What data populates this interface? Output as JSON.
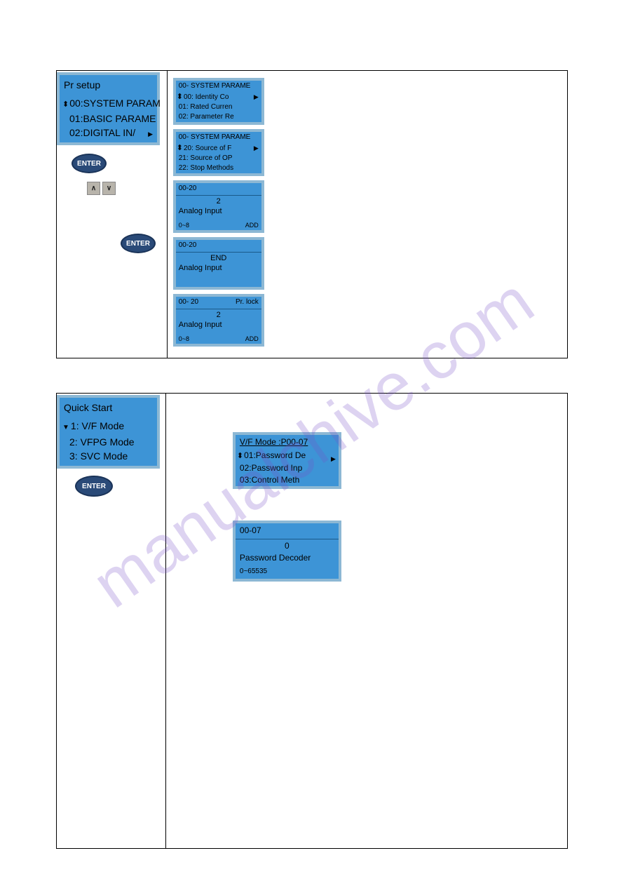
{
  "watermark": "manualchive.com",
  "section1": {
    "pr_setup": {
      "title": "Pr setup",
      "items": [
        "00:SYSTEM PARAM",
        "01:BASIC PARAME",
        "02:DIGITAL IN/"
      ]
    },
    "enter_label": "ENTER",
    "arrow_up": "∧",
    "arrow_down": "∨",
    "panels": [
      {
        "header": "00- SYSTEM PARAME",
        "rows": [
          "00: Identity Co",
          "01: Rated Curren",
          "02: Parameter Re"
        ]
      },
      {
        "header": "00- SYSTEM PARAME",
        "rows": [
          "20: Source of F",
          "21: Source of OP",
          "22: Stop Methods"
        ]
      },
      {
        "header": "00-20",
        "value": "2",
        "label": "Analog Input",
        "foot_left": "0~8",
        "foot_right": "ADD"
      },
      {
        "header": "00-20",
        "value": "END",
        "label": "Analog Input"
      },
      {
        "header_left": "00- 20",
        "header_right": "Pr. lock",
        "value": "2",
        "label": "Analog Input",
        "foot_left": "0~8",
        "foot_right": "ADD"
      }
    ]
  },
  "section2": {
    "quick_start": {
      "title": "Quick Start",
      "items": [
        "1: V/F Mode",
        "2: VFPG Mode",
        "3: SVC Mode"
      ]
    },
    "enter_label": "ENTER",
    "vf_panel": {
      "header": "V/F Mode :P00-07",
      "rows": [
        "01:Password De",
        "02:Password Inp",
        "03:Control Meth"
      ]
    },
    "pw_panel": {
      "header": "00-07",
      "value": "0",
      "label": "Password Decoder",
      "foot": "0~65535"
    }
  }
}
